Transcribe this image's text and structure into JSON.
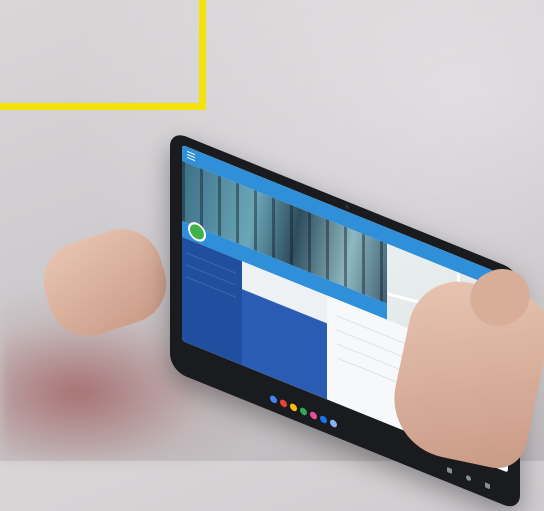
{
  "scene": {
    "description_colors": {
      "wall": "#cfcccf",
      "accent_frame": "#f4e20c",
      "tablet_body": "#1a1b1e",
      "app_primary": "#2f8fd8",
      "app_dark": "#1f4f9e",
      "map_pin": "#39b54a"
    }
  },
  "tablet": {
    "app_bar": {
      "title": "",
      "menu_icon": "menu-icon"
    },
    "profile": {
      "badge_icon": "location-badge-icon",
      "name": ""
    },
    "panel": {
      "label_top": "",
      "label_bottom": ""
    },
    "map": {
      "pin_icon": "map-pin-icon"
    },
    "fab_icon": "action-fab-icon",
    "dock_colors": [
      "#4285f4",
      "#ea4335",
      "#fbbc05",
      "#34a853",
      "#e94e9c",
      "#1a73e8",
      "#8ab4f8"
    ]
  }
}
